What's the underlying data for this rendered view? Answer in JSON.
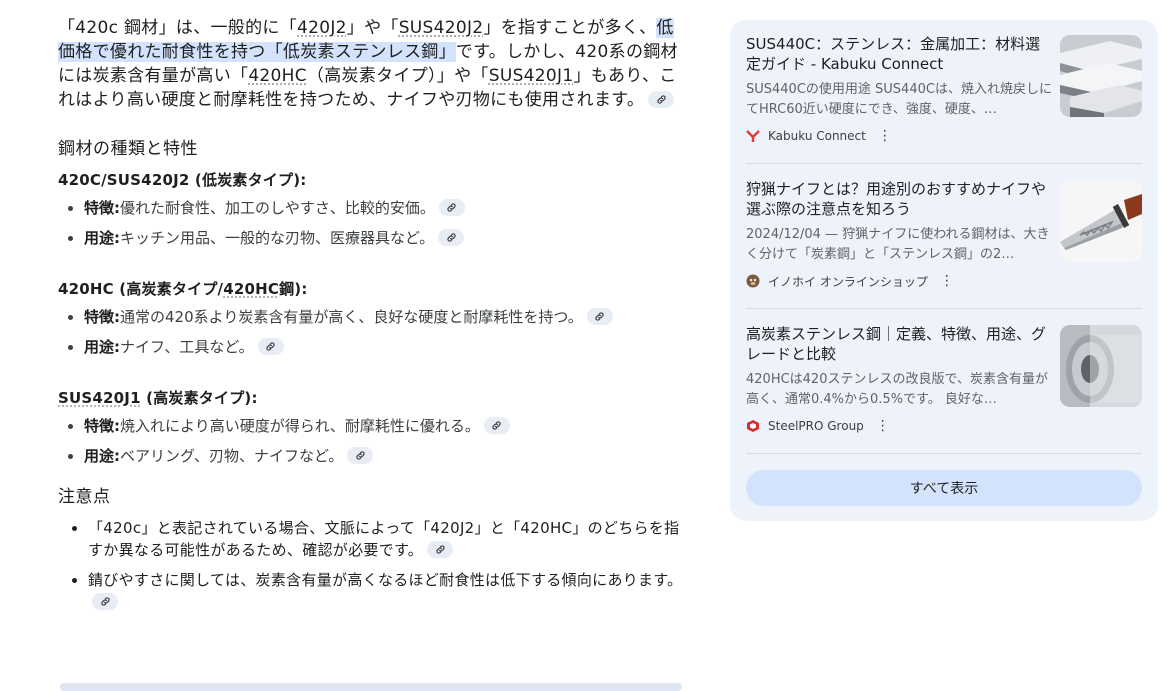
{
  "answer": {
    "intro": {
      "p1": "「420c 鋼材」は、一般的に「",
      "l1": "420J2",
      "p2": "」や「",
      "l2": "SUS420J2",
      "p3": "」を指すことが多く、",
      "highlight": "低価格で優れた耐食性を持つ「低炭素ステンレス鋼」",
      "p4": "です。しかし、420系の鋼材には炭素含有量が高い「",
      "l3": "420HC",
      "p5": "（高炭素タイプ）」や「",
      "l4": "SUS420J1",
      "p6": "」もあり、これはより高い硬度と耐摩耗性を持つため、ナイフや刃物にも使用されます。"
    },
    "section1_heading": "鋼材の種類と特性",
    "types": [
      {
        "title": "420C/SUS420J2 (低炭素タイプ):",
        "items": [
          {
            "label": "特徴:",
            "text": "優れた耐食性、加工のしやすさ、比較的安価。"
          },
          {
            "label": "用途:",
            "text": "キッチン用品、一般的な刃物、医療器具など。"
          }
        ]
      },
      {
        "title_a": "420HC (高炭素タイプ/",
        "title_link": "420HC",
        "title_b": "鋼):",
        "items": [
          {
            "label": "特徴:",
            "text": "通常の420系より炭素含有量が高く、良好な硬度と耐摩耗性を持つ。"
          },
          {
            "label": "用途:",
            "text": "ナイフ、工具など。"
          }
        ]
      },
      {
        "title_link": "SUS420J1",
        "title_b": " (高炭素タイプ):",
        "items": [
          {
            "label": "特徴:",
            "text": "焼入れにより高い硬度が得られ、耐摩耗性に優れる。"
          },
          {
            "label": "用途:",
            "text": "ベアリング、刃物、ナイフなど。"
          }
        ]
      }
    ],
    "section2_heading": "注意点",
    "notes": [
      "「420c」と表記されている場合、文脈によって「420J2」と「420HC」のどちらを指すか異なる可能性があるため、確認が必要です。",
      "錆びやすさに関しては、炭素含有量が高くなるほど耐食性は低下する傾向にあります。"
    ]
  },
  "sources": [
    {
      "title": "SUS440C：ステンレス：金属加工：材料選定ガイド - Kabuku Connect",
      "snippet": "SUS440Cの使用用途 SUS440Cは、焼入れ焼戻しにてHRC60近い硬度にでき、強度、硬度、…",
      "site": "Kabuku Connect",
      "icon": "kabuku-logo-icon"
    },
    {
      "title": "狩猟ナイフとは？用途別のおすすめナイフや選ぶ際の注意点を知ろう",
      "snippet": "2024/12/04 — 狩猟ナイフに使われる鋼材は、大きく分けて「炭素鋼」と「ステンレス鋼」の2…",
      "site": "イノホイ オンラインショップ",
      "icon": "inohoi-logo-icon"
    },
    {
      "title": "高炭素ステンレス鋼｜定義、特徴、用途、グレードと比較",
      "snippet": "420HCは420ステンレスの改良版で、炭素含有量が高く、通常0.4%から0.5%です。 良好な…",
      "site": "SteelPRO Group",
      "icon": "steelpro-logo-icon"
    }
  ],
  "show_all_label": "すべて表示",
  "more_glyph": "⋮",
  "colors": {
    "highlight": "#d3e3fd",
    "panel_bg": "#eef3fb",
    "chip_bg": "#e8edf5"
  }
}
